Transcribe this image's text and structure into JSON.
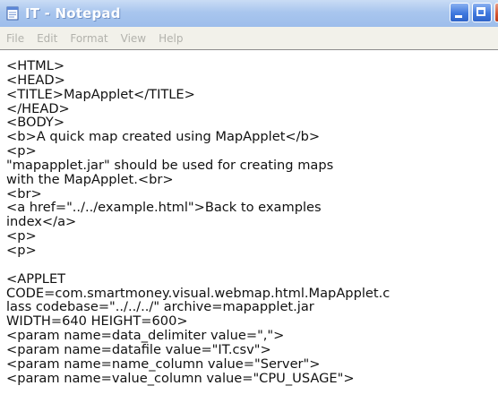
{
  "window": {
    "title": "IT - Notepad",
    "icon": "notepad-icon"
  },
  "menu": [
    "File",
    "Edit",
    "Format",
    "View",
    "Help"
  ],
  "document": {
    "lines": [
      "<HTML>",
      "<HEAD>",
      "<TITLE>MapApplet</TITLE>",
      "</HEAD>",
      "<BODY>",
      "<b>A quick map created using MapApplet</b>",
      "<p>",
      "\"mapapplet.jar\" should be used for creating maps",
      "with the MapApplet.<br>",
      "<br>",
      "<a href=\"../../example.html\">Back to examples",
      "index</a>",
      "<p>",
      "<p>",
      "",
      "<APPLET",
      "CODE=com.smartmoney.visual.webmap.html.MapApplet.c",
      "lass codebase=\"../../../\" archive=mapapplet.jar",
      "WIDTH=640 HEIGHT=600>",
      "<param name=data_delimiter value=\",\">",
      "<param name=datafile value=\"IT.csv\">",
      "<param name=name_column value=\"Server\">",
      "<param name=value_column value=\"CPU_USAGE\">"
    ]
  }
}
